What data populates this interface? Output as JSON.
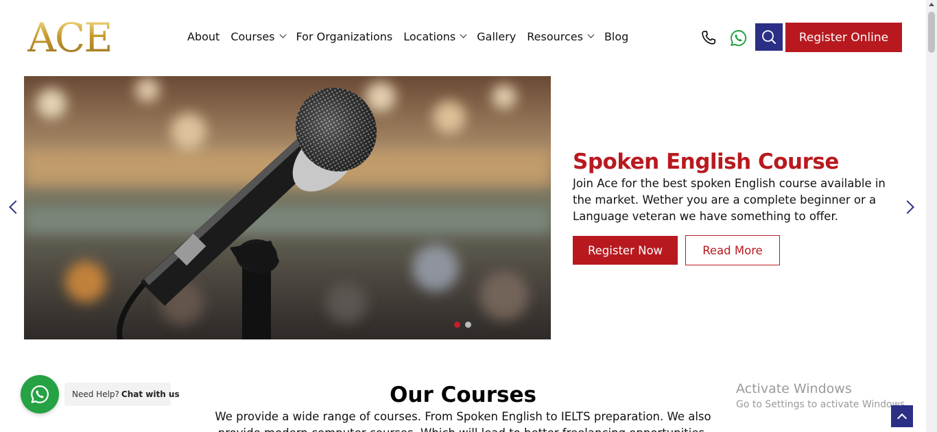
{
  "brand": {
    "logo_text": "ACE"
  },
  "nav": {
    "items": [
      {
        "label": "About",
        "has_dropdown": false
      },
      {
        "label": "Courses",
        "has_dropdown": true
      },
      {
        "label": "For Organizations",
        "has_dropdown": false
      },
      {
        "label": "Locations",
        "has_dropdown": true
      },
      {
        "label": "Gallery",
        "has_dropdown": false
      },
      {
        "label": "Resources",
        "has_dropdown": true
      },
      {
        "label": "Blog",
        "has_dropdown": false
      }
    ]
  },
  "header_actions": {
    "icons": [
      "phone-icon",
      "whatsapp-icon",
      "search-icon"
    ],
    "register_label": "Register Online"
  },
  "hero": {
    "title": "Spoken English Course",
    "description": "Join Ace for the best spoken English course available in the market. Wether you are a complete beginner or a Language veteran we have something to offer.",
    "primary_button": "Register Now",
    "secondary_button": "Read More",
    "slide_count": 2,
    "active_slide": 1
  },
  "courses": {
    "title": "Our Courses",
    "description": "We provide a wide range of courses. From Spoken English to IELTS preparation. We also provide modern computer courses. Which will lead to better freelancing opportunities."
  },
  "chat": {
    "prefix": "Need Help?",
    "cta": "Chat with us"
  },
  "watermark": {
    "line1": "Activate Windows",
    "line2": "Go to Settings to activate Windows."
  },
  "colors": {
    "brand_red": "#b8191f",
    "brand_navy": "#2b2f86",
    "whatsapp_green": "#25a244"
  }
}
